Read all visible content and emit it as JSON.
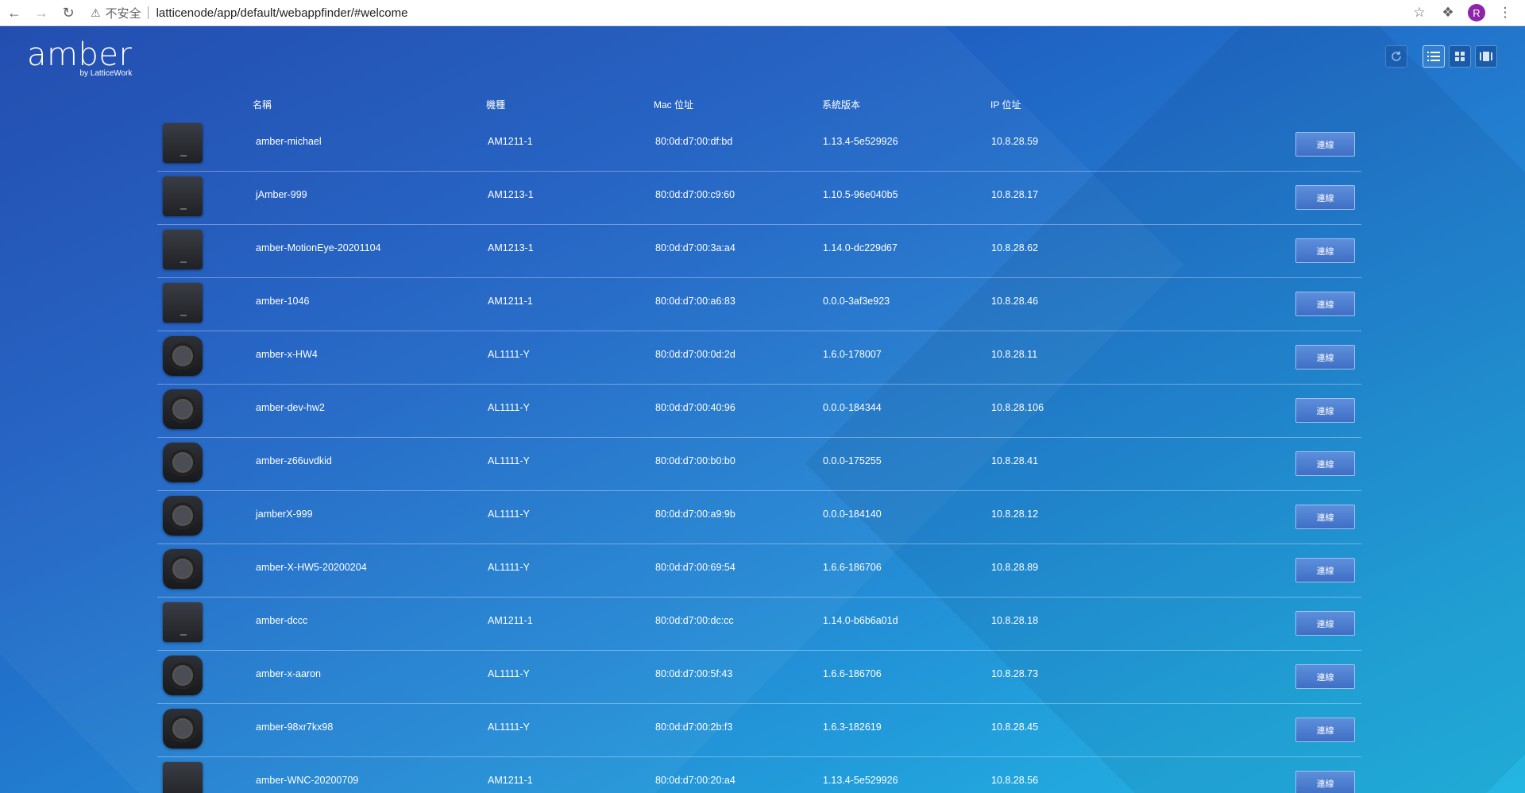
{
  "browser": {
    "insecure_label": "不安全",
    "url": "latticenode/app/default/webappfinder/#welcome",
    "avatar_letter": "R"
  },
  "app": {
    "logo_main": "amber",
    "logo_sub": "by LatticeWork"
  },
  "table": {
    "columns": [
      "名稱",
      "機種",
      "Mac 位址",
      "系統版本",
      "IP 位址"
    ],
    "connect_label": "連線",
    "rows": [
      {
        "name": "amber-michael",
        "model": "AM1211-1",
        "mac": "80:0d:d7:00:df:bd",
        "version": "1.13.4-5e529926",
        "ip": "10.8.28.59",
        "device": "cube"
      },
      {
        "name": "jAmber-999",
        "model": "AM1213-1",
        "mac": "80:0d:d7:00:c9:60",
        "version": "1.10.5-96e040b5",
        "ip": "10.8.28.17",
        "device": "cube"
      },
      {
        "name": "amber-MotionEye-20201104",
        "model": "AM1213-1",
        "mac": "80:0d:d7:00:3a:a4",
        "version": "1.14.0-dc229d67",
        "ip": "10.8.28.62",
        "device": "cube"
      },
      {
        "name": "amber-1046",
        "model": "AM1211-1",
        "mac": "80:0d:d7:00:a6:83",
        "version": "0.0.0-3af3e923",
        "ip": "10.8.28.46",
        "device": "cube"
      },
      {
        "name": "amber-x-HW4",
        "model": "AL1111-Y",
        "mac": "80:0d:d7:00:0d:2d",
        "version": "1.6.0-178007",
        "ip": "10.8.28.11",
        "device": "round"
      },
      {
        "name": "amber-dev-hw2",
        "model": "AL1111-Y",
        "mac": "80:0d:d7:00:40:96",
        "version": "0.0.0-184344",
        "ip": "10.8.28.106",
        "device": "round"
      },
      {
        "name": "amber-z66uvdkid",
        "model": "AL1111-Y",
        "mac": "80:0d:d7:00:b0:b0",
        "version": "0.0.0-175255",
        "ip": "10.8.28.41",
        "device": "round"
      },
      {
        "name": "jamberX-999",
        "model": "AL1111-Y",
        "mac": "80:0d:d7:00:a9:9b",
        "version": "0.0.0-184140",
        "ip": "10.8.28.12",
        "device": "round"
      },
      {
        "name": "amber-X-HW5-20200204",
        "model": "AL1111-Y",
        "mac": "80:0d:d7:00:69:54",
        "version": "1.6.6-186706",
        "ip": "10.8.28.89",
        "device": "round"
      },
      {
        "name": "amber-dccc",
        "model": "AM1211-1",
        "mac": "80:0d:d7:00:dc:cc",
        "version": "1.14.0-b6b6a01d",
        "ip": "10.8.28.18",
        "device": "cube"
      },
      {
        "name": "amber-x-aaron",
        "model": "AL1111-Y",
        "mac": "80:0d:d7:00:5f:43",
        "version": "1.6.6-186706",
        "ip": "10.8.28.73",
        "device": "round"
      },
      {
        "name": "amber-98xr7kx98",
        "model": "AL1111-Y",
        "mac": "80:0d:d7:00:2b:f3",
        "version": "1.6.3-182619",
        "ip": "10.8.28.45",
        "device": "round"
      },
      {
        "name": "amber-WNC-20200709",
        "model": "AM1211-1",
        "mac": "80:0d:d7:00:20:a4",
        "version": "1.13.4-5e529926",
        "ip": "10.8.28.56",
        "device": "cube"
      }
    ]
  }
}
